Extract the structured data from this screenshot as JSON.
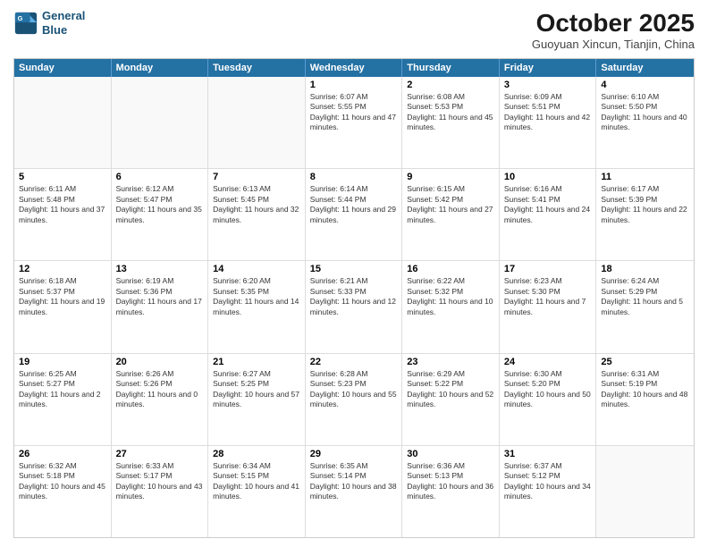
{
  "header": {
    "logo_line1": "General",
    "logo_line2": "Blue",
    "month": "October 2025",
    "location": "Guoyuan Xincun, Tianjin, China"
  },
  "days_of_week": [
    "Sunday",
    "Monday",
    "Tuesday",
    "Wednesday",
    "Thursday",
    "Friday",
    "Saturday"
  ],
  "weeks": [
    [
      {
        "day": "",
        "text": ""
      },
      {
        "day": "",
        "text": ""
      },
      {
        "day": "",
        "text": ""
      },
      {
        "day": "1",
        "text": "Sunrise: 6:07 AM\nSunset: 5:55 PM\nDaylight: 11 hours and 47 minutes."
      },
      {
        "day": "2",
        "text": "Sunrise: 6:08 AM\nSunset: 5:53 PM\nDaylight: 11 hours and 45 minutes."
      },
      {
        "day": "3",
        "text": "Sunrise: 6:09 AM\nSunset: 5:51 PM\nDaylight: 11 hours and 42 minutes."
      },
      {
        "day": "4",
        "text": "Sunrise: 6:10 AM\nSunset: 5:50 PM\nDaylight: 11 hours and 40 minutes."
      }
    ],
    [
      {
        "day": "5",
        "text": "Sunrise: 6:11 AM\nSunset: 5:48 PM\nDaylight: 11 hours and 37 minutes."
      },
      {
        "day": "6",
        "text": "Sunrise: 6:12 AM\nSunset: 5:47 PM\nDaylight: 11 hours and 35 minutes."
      },
      {
        "day": "7",
        "text": "Sunrise: 6:13 AM\nSunset: 5:45 PM\nDaylight: 11 hours and 32 minutes."
      },
      {
        "day": "8",
        "text": "Sunrise: 6:14 AM\nSunset: 5:44 PM\nDaylight: 11 hours and 29 minutes."
      },
      {
        "day": "9",
        "text": "Sunrise: 6:15 AM\nSunset: 5:42 PM\nDaylight: 11 hours and 27 minutes."
      },
      {
        "day": "10",
        "text": "Sunrise: 6:16 AM\nSunset: 5:41 PM\nDaylight: 11 hours and 24 minutes."
      },
      {
        "day": "11",
        "text": "Sunrise: 6:17 AM\nSunset: 5:39 PM\nDaylight: 11 hours and 22 minutes."
      }
    ],
    [
      {
        "day": "12",
        "text": "Sunrise: 6:18 AM\nSunset: 5:37 PM\nDaylight: 11 hours and 19 minutes."
      },
      {
        "day": "13",
        "text": "Sunrise: 6:19 AM\nSunset: 5:36 PM\nDaylight: 11 hours and 17 minutes."
      },
      {
        "day": "14",
        "text": "Sunrise: 6:20 AM\nSunset: 5:35 PM\nDaylight: 11 hours and 14 minutes."
      },
      {
        "day": "15",
        "text": "Sunrise: 6:21 AM\nSunset: 5:33 PM\nDaylight: 11 hours and 12 minutes."
      },
      {
        "day": "16",
        "text": "Sunrise: 6:22 AM\nSunset: 5:32 PM\nDaylight: 11 hours and 10 minutes."
      },
      {
        "day": "17",
        "text": "Sunrise: 6:23 AM\nSunset: 5:30 PM\nDaylight: 11 hours and 7 minutes."
      },
      {
        "day": "18",
        "text": "Sunrise: 6:24 AM\nSunset: 5:29 PM\nDaylight: 11 hours and 5 minutes."
      }
    ],
    [
      {
        "day": "19",
        "text": "Sunrise: 6:25 AM\nSunset: 5:27 PM\nDaylight: 11 hours and 2 minutes."
      },
      {
        "day": "20",
        "text": "Sunrise: 6:26 AM\nSunset: 5:26 PM\nDaylight: 11 hours and 0 minutes."
      },
      {
        "day": "21",
        "text": "Sunrise: 6:27 AM\nSunset: 5:25 PM\nDaylight: 10 hours and 57 minutes."
      },
      {
        "day": "22",
        "text": "Sunrise: 6:28 AM\nSunset: 5:23 PM\nDaylight: 10 hours and 55 minutes."
      },
      {
        "day": "23",
        "text": "Sunrise: 6:29 AM\nSunset: 5:22 PM\nDaylight: 10 hours and 52 minutes."
      },
      {
        "day": "24",
        "text": "Sunrise: 6:30 AM\nSunset: 5:20 PM\nDaylight: 10 hours and 50 minutes."
      },
      {
        "day": "25",
        "text": "Sunrise: 6:31 AM\nSunset: 5:19 PM\nDaylight: 10 hours and 48 minutes."
      }
    ],
    [
      {
        "day": "26",
        "text": "Sunrise: 6:32 AM\nSunset: 5:18 PM\nDaylight: 10 hours and 45 minutes."
      },
      {
        "day": "27",
        "text": "Sunrise: 6:33 AM\nSunset: 5:17 PM\nDaylight: 10 hours and 43 minutes."
      },
      {
        "day": "28",
        "text": "Sunrise: 6:34 AM\nSunset: 5:15 PM\nDaylight: 10 hours and 41 minutes."
      },
      {
        "day": "29",
        "text": "Sunrise: 6:35 AM\nSunset: 5:14 PM\nDaylight: 10 hours and 38 minutes."
      },
      {
        "day": "30",
        "text": "Sunrise: 6:36 AM\nSunset: 5:13 PM\nDaylight: 10 hours and 36 minutes."
      },
      {
        "day": "31",
        "text": "Sunrise: 6:37 AM\nSunset: 5:12 PM\nDaylight: 10 hours and 34 minutes."
      },
      {
        "day": "",
        "text": ""
      }
    ]
  ]
}
